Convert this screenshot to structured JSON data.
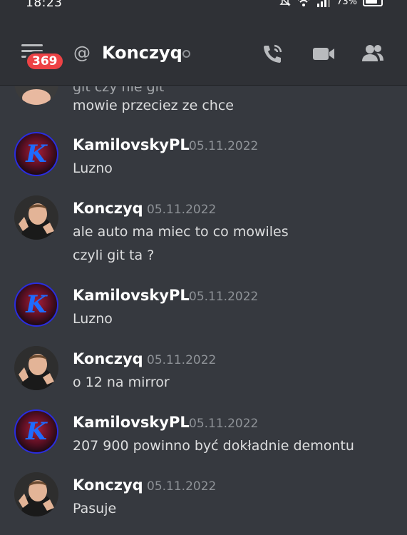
{
  "status": {
    "time": "18:23",
    "battery": "73%"
  },
  "header": {
    "badge": "369",
    "at": "@",
    "title": "Konczyq"
  },
  "partial_text": "git czy nie git",
  "messages": [
    {
      "type": "continuation",
      "text": "mowie przeciez ze chce"
    },
    {
      "author": "KamilovskyPL",
      "date": "05.11.2022",
      "lines": [
        "Luzno"
      ]
    },
    {
      "author": "Konczyq",
      "date": "05.11.2022",
      "lines": [
        "ale auto ma miec to co mowiles",
        "czyli git ta ?"
      ]
    },
    {
      "author": "KamilovskyPL",
      "date": "05.11.2022",
      "lines": [
        "Luzno"
      ]
    },
    {
      "author": "Konczyq",
      "date": "05.11.2022",
      "lines": [
        "o 12 na mirror"
      ]
    },
    {
      "author": "KamilovskyPL",
      "date": "05.11.2022",
      "lines": [
        "207 900 powinno być dokładnie demontu"
      ]
    },
    {
      "author": "Konczyq",
      "date": "05.11.2022",
      "lines": [
        "Pasuje"
      ]
    }
  ],
  "avatar_letter": "K",
  "colors": {
    "background": "#36393f",
    "header": "#2f3136",
    "badge": "#ed4245",
    "date": "#8e9297"
  },
  "icons": [
    "hamburger-icon",
    "call-icon",
    "video-icon",
    "members-icon",
    "muted-bell-icon",
    "wifi-icon",
    "signal-icon",
    "battery-icon"
  ]
}
